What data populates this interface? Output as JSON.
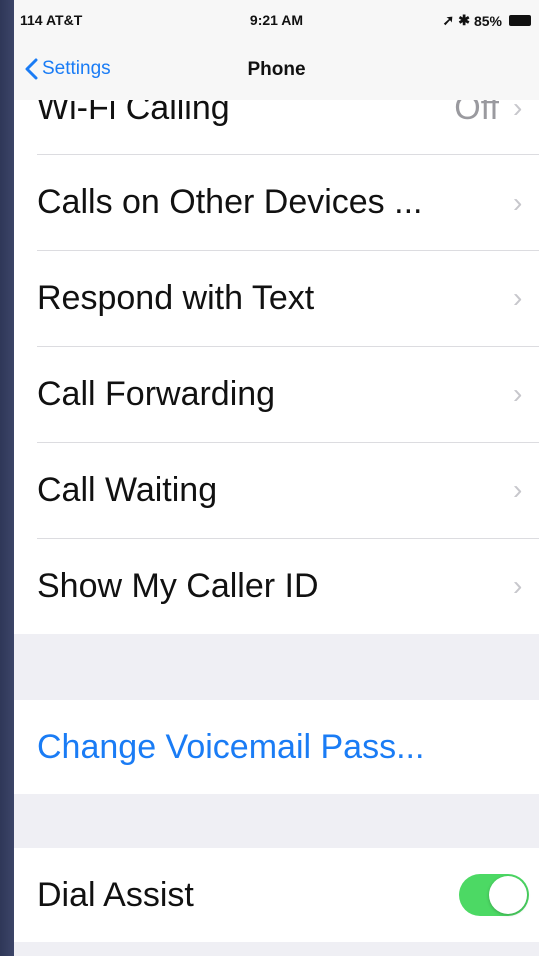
{
  "status_bar": {
    "carrier": "114 AT&T",
    "time": "9:21 AM",
    "battery": "85%"
  },
  "nav": {
    "back_label": "Settings",
    "title": "Phone"
  },
  "rows_group_1": [
    {
      "label": "Wi-Fi Calling",
      "value": "Off"
    },
    {
      "label": "Calls on Other Devices ...",
      "value": ""
    },
    {
      "label": "Respond with Text",
      "value": ""
    },
    {
      "label": "Call Forwarding",
      "value": ""
    },
    {
      "label": "Call Waiting",
      "value": ""
    },
    {
      "label": "Show My Caller ID",
      "value": ""
    }
  ],
  "voicemail": {
    "label": "Change Voicemail Pass..."
  },
  "dial_assist": {
    "label": "Dial Assist",
    "enabled": true
  },
  "colors": {
    "accent": "#1a7cf5",
    "toggle_on": "#4cd964"
  }
}
